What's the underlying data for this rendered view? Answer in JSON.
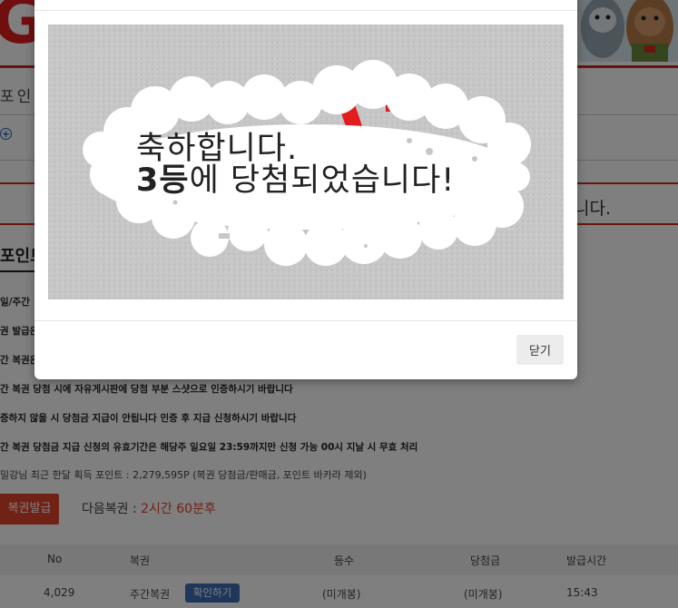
{
  "header": {
    "logo_letter": "G",
    "nav_label": "포인트"
  },
  "banner": {
    "text_tail": "니다."
  },
  "section": {
    "title": "포인트"
  },
  "notices": [
    "일/주간",
    "권 발급은",
    "간 복권은",
    "간 복권 당첨 시에 자유게시판에 당첨 부분 스샷으로 인증하시기 바랍니다",
    "증하지 않을 시 당첨금 지급이 안됩니다 인증 후 지급 신청하시기 바랍니다",
    "간 복권 당첨금 지급 신청의 유효기간은 해당주 일요일 23:59까지만 신청 가능 00시 지날 시 무효 처리"
  ],
  "points_text": "밀강님 최근 한달 획득 포인트 : 2,279,595P (복권 당첨금/판매금, 포인트 바카라 제외)",
  "issue_button": "복권발급",
  "next_lottery": {
    "label": "다음복권 : ",
    "value": "2시간 60분후"
  },
  "table": {
    "headers": [
      "No",
      "복권",
      "등수",
      "당첨금",
      "발급시간"
    ],
    "rows": [
      {
        "no": "4,029",
        "type": "주간복권",
        "action": "확인하기",
        "rank": "(미개봉)",
        "prize": "(미개봉)",
        "time": "15:43"
      }
    ]
  },
  "modal": {
    "line1": "축하합니다.",
    "rank": "3등",
    "line2_rest": "에 당첨되었습니다!",
    "close_label": "닫기"
  },
  "colors": {
    "accent_red": "#e2452d",
    "button_blue": "#3c6fb6"
  }
}
